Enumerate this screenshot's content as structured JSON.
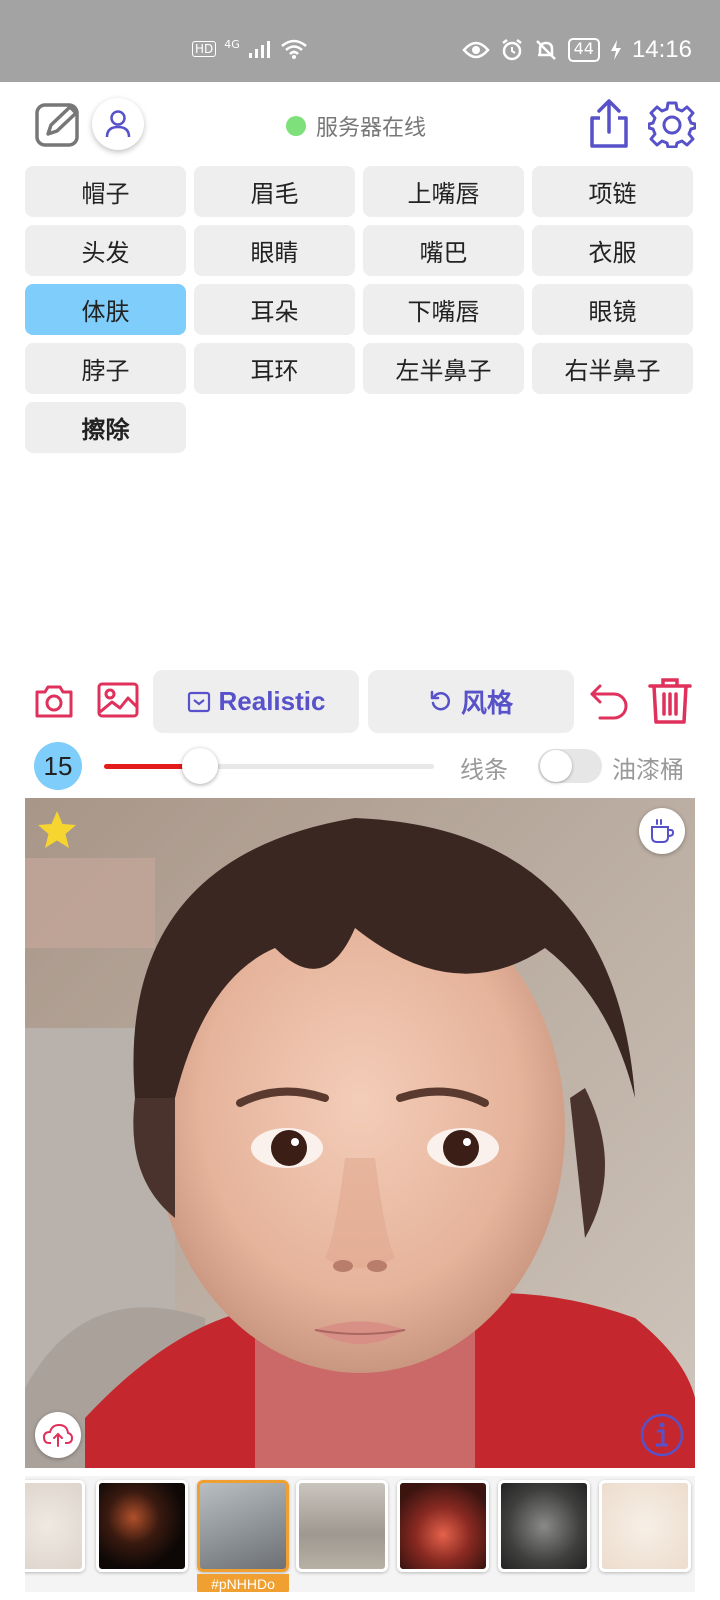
{
  "status_bar": {
    "network_badge": "HD",
    "network_type": "4G",
    "battery": "44",
    "time": "14:16",
    "icons": [
      "signal-icon",
      "wifi-icon",
      "eye-icon",
      "alarm-icon",
      "mute-icon",
      "battery-icon",
      "charging-icon"
    ]
  },
  "header": {
    "server_status": "服务器在线",
    "server_status_color": "#7de07a",
    "accent_color": "#5752c9"
  },
  "tags": [
    {
      "label": "帽子",
      "active": false
    },
    {
      "label": "眉毛",
      "active": false
    },
    {
      "label": "上嘴唇",
      "active": false
    },
    {
      "label": "项链",
      "active": false
    },
    {
      "label": "头发",
      "active": false
    },
    {
      "label": "眼睛",
      "active": false
    },
    {
      "label": "嘴巴",
      "active": false
    },
    {
      "label": "衣服",
      "active": false
    },
    {
      "label": "体肤",
      "active": true
    },
    {
      "label": "耳朵",
      "active": false
    },
    {
      "label": "下嘴唇",
      "active": false
    },
    {
      "label": "眼镜",
      "active": false
    },
    {
      "label": "脖子",
      "active": false
    },
    {
      "label": "耳环",
      "active": false
    },
    {
      "label": "左半鼻子",
      "active": false
    },
    {
      "label": "右半鼻子",
      "active": false
    },
    {
      "label": "擦除",
      "active": false
    }
  ],
  "toolbar": {
    "mode_label": "Realistic",
    "style_label": "风格"
  },
  "brush": {
    "size": "15",
    "slider_fraction": 0.29,
    "line_label": "线条",
    "bucket_label": "油漆桶",
    "bucket_enabled": false
  },
  "thumbnails": {
    "selected_label": "#pNHHDo",
    "selected_index": 2
  }
}
